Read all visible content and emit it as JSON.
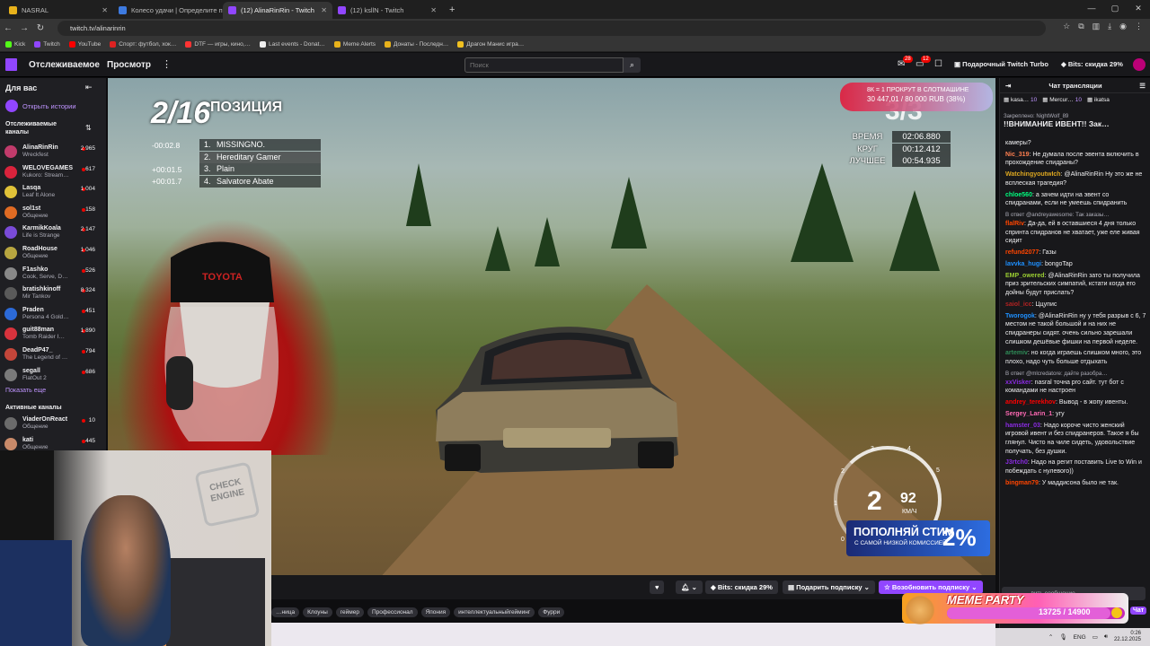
{
  "browser": {
    "tabs": [
      {
        "title": "NASRAL",
        "color": "#e8b21b"
      },
      {
        "title": "Колесо удачи | Определите п…",
        "color": "#3d7ae0"
      },
      {
        "title": "(12) AlinaRinRin - Twitch",
        "color": "#9146ff",
        "active": true
      },
      {
        "title": "(12) ksllN - Twitch",
        "color": "#9146ff"
      }
    ],
    "new_tab": "+",
    "url": "twitch.tv/alinarinrin",
    "bookmarks": [
      "Kick",
      "Twitch",
      "YouTube",
      "Спорт: футбол, хок…",
      "DTF — игры, кино,…",
      "Last events - Donat…",
      "Meme Alerts",
      "Донаты - Последн…",
      "Драгон Манис игра…"
    ]
  },
  "header": {
    "following": "Отслеживаемое",
    "browse": "Просмотр",
    "more": "⋮",
    "search_placeholder": "Поиск",
    "notif_badge_1": "28",
    "notif_badge_2": "12",
    "turbo": "Подарочный Twitch Turbo",
    "bits_discount": "Bits: скидка 29%"
  },
  "sidebar": {
    "title": "Для вас",
    "history": "Открыть истории",
    "followed_title": "Отслеживаемые каналы",
    "channels": [
      {
        "name": "AlinaRinRin",
        "game": "Wreckfest",
        "viewers": "2 965",
        "color": "#c13b6b"
      },
      {
        "name": "WELOVEGAMES",
        "game": "Kukoro: Stream…",
        "viewers": "617",
        "color": "#d9233c"
      },
      {
        "name": "Lasqa",
        "game": "Leaf It Alone",
        "viewers": "1 004",
        "color": "#e0c238"
      },
      {
        "name": "sol1st",
        "game": "Общение",
        "viewers": "158",
        "color": "#e06b23"
      },
      {
        "name": "KarmikKoala",
        "game": "Life is Strange",
        "viewers": "2 147",
        "color": "#7a4bd8"
      },
      {
        "name": "RoadHouse",
        "game": "Общение",
        "viewers": "1 046",
        "color": "#b8a640"
      },
      {
        "name": "F1ashko",
        "game": "Cook, Serve, D…",
        "viewers": "526",
        "color": "#888888"
      },
      {
        "name": "bratishkinoff",
        "game": "Mir Tankov",
        "viewers": "8 324",
        "color": "#5a5a5a"
      },
      {
        "name": "Praden",
        "game": "Persona 4 Gold…",
        "viewers": "451",
        "color": "#2c6ad8"
      },
      {
        "name": "guit88man",
        "game": "Tomb Raider I…",
        "viewers": "1 890",
        "color": "#d8333d"
      },
      {
        "name": "DeadP47_",
        "game": "The Legend of …",
        "viewers": "794",
        "color": "#c4463a"
      },
      {
        "name": "segall",
        "game": "FlatOut 2",
        "viewers": "686",
        "color": "#7a7a7a"
      }
    ],
    "show_more": "Показать еще",
    "active_title": "Активные каналы",
    "active_channels": [
      {
        "name": "ViaderOnReact",
        "game": "Общение",
        "viewers": "10",
        "color": "#6b6b6b"
      },
      {
        "name": "kati",
        "game": "Общение",
        "viewers": "445",
        "color": "#c98a6a"
      }
    ]
  },
  "game_hud": {
    "position": "2/16",
    "position_label": "ПОЗИЦИЯ",
    "leaderboard": [
      {
        "gap": "-00:02.8",
        "rank": "1.",
        "name": "MISSINGNO."
      },
      {
        "gap": "",
        "rank": "2.",
        "name": "Hereditary Gamer"
      },
      {
        "gap": "+00:01.5",
        "rank": "3.",
        "name": "Plain"
      },
      {
        "gap": "+00:01.7",
        "rank": "4.",
        "name": "Salvatore Abate"
      }
    ],
    "donation_line1": "8К = 1 ПРОКРУТ В СЛОТМАШИНЕ",
    "donation_line2": "30 447,01 / 80 000 RUB (38%)",
    "lap": "3/3",
    "times": [
      {
        "label": "ВРЕМЯ",
        "value": "02:06.880"
      },
      {
        "label": "КРУГ",
        "value": "00:12.412"
      },
      {
        "label": "ЛУЧШЕЕ",
        "value": "00:54.935"
      }
    ],
    "gear": "2",
    "speed": "92",
    "speed_unit": "КМ/Ч",
    "rpm_ticks": [
      "1",
      "2",
      "3",
      "4",
      "5",
      "0"
    ],
    "promo_title": "ПОПОЛНЯЙ СТИМ",
    "promo_sub": "С САМОЙ НИЗКОЙ КОМИССИЕЙ",
    "promo_pct": "2%",
    "cap_text": "TOYOTA",
    "webcam_sign": "CHECK ENGINE"
  },
  "player_bar": {
    "bits": "Bits: скидка 29%",
    "gift": "Подарить подписку",
    "resub": "Возобновить подписку"
  },
  "tags": [
    "…ница",
    "Клоуны",
    "геймер",
    "Профессионал",
    "Япония",
    "интеллектуальныйгейминг",
    "Фурри"
  ],
  "chat": {
    "title": "Чат трансляции",
    "gifters": [
      {
        "name": "kasa…",
        "count": "10"
      },
      {
        "name": "Mercur…",
        "count": "10"
      },
      {
        "name": "ikatsa",
        "count": ""
      }
    ],
    "pinned_by": "Закреплено: NightWolf_89",
    "pinned_text": "!!ВНИМАНИЕ ИВЕНТ!! Зак…",
    "messages": [
      {
        "user": "",
        "color": "#00ff7f",
        "text": "камеры?"
      },
      {
        "user": "Nic_319",
        "color": "#ff7f50",
        "text": "Не думала после эвента включить в прохождение спидраны?"
      },
      {
        "user": "WatchingyoutwIch",
        "color": "#daa520",
        "text": "@AlinaRinRin Ну это же не всплеская трагедия?"
      },
      {
        "user": "chloe560",
        "color": "#00ff7f",
        "text": "а зачем идти на эвент со спидранами, если не умеешь спидранить"
      },
      {
        "user": "flalRiv",
        "color": "#ff4500",
        "reply": "В ответ @andreyawesome: Так заказы…",
        "text": "Да-да, ей в оставшиеся 4 дня только спринта спидранов не хватает, уже еле живая сидит"
      },
      {
        "user": "refund2077",
        "color": "#ff4500",
        "text": "Газы"
      },
      {
        "user": "lavvka_hugi",
        "color": "#1e90ff",
        "text": "bongoTap"
      },
      {
        "user": "EMP_owered",
        "color": "#9acd32",
        "text": "@AlinaRinRin зато ты получила приз зрительских симпатий, кстати когда его дойны будут прислать?"
      },
      {
        "user": "saiol_icc",
        "color": "#b22222",
        "text": "Ццупис"
      },
      {
        "user": "Tworogok",
        "color": "#1e90ff",
        "text": "@AlinaRinRin ну у тебя разрыв с 6, 7 местом не такой большой и на них не спидранеры сидят. очень сильно зарешали слишком дешёвые фишки на первой неделе."
      },
      {
        "user": "artemiv",
        "color": "#2e8b57",
        "text": "но когда играешь слишком много, это плохо, надо чуть больше отдыхать"
      },
      {
        "user": "xxVisker",
        "color": "#8a2be2",
        "reply": "В ответ @mlcredatore: дайте разобра…",
        "text": "nasral точна pro сайт. тут бот с командами не настроен"
      },
      {
        "user": "andrey_terekhov",
        "color": "#ff0000",
        "text": "Вывод - в жопу ивенты."
      },
      {
        "user": "Sergey_Larin_1",
        "color": "#ff69b4",
        "text": "угу"
      },
      {
        "user": "hamster_03",
        "color": "#8a2be2",
        "text": "Надо короче чисто женский игровой ивент и без спидранеров. Такое я бы глянул. Чисто на чиле сидеть, удовольствие получать, без душки."
      },
      {
        "user": "J3rtch0",
        "color": "#8a2be2",
        "text": "Надо на регит поставить Live to Win и побеждать с нулевого))"
      },
      {
        "user": "bingman79",
        "color": "#ff4500",
        "text": "У маддисона было не так."
      }
    ],
    "input_placeholder": "…вить сообщение",
    "send": "Чат"
  },
  "meme_party": {
    "title": "MEME PARTY",
    "count": "13725 / 14900",
    "progress": 0.921
  },
  "taskbar": {
    "lang": "ENG",
    "time": "0:26",
    "date": "22.12.2025"
  }
}
